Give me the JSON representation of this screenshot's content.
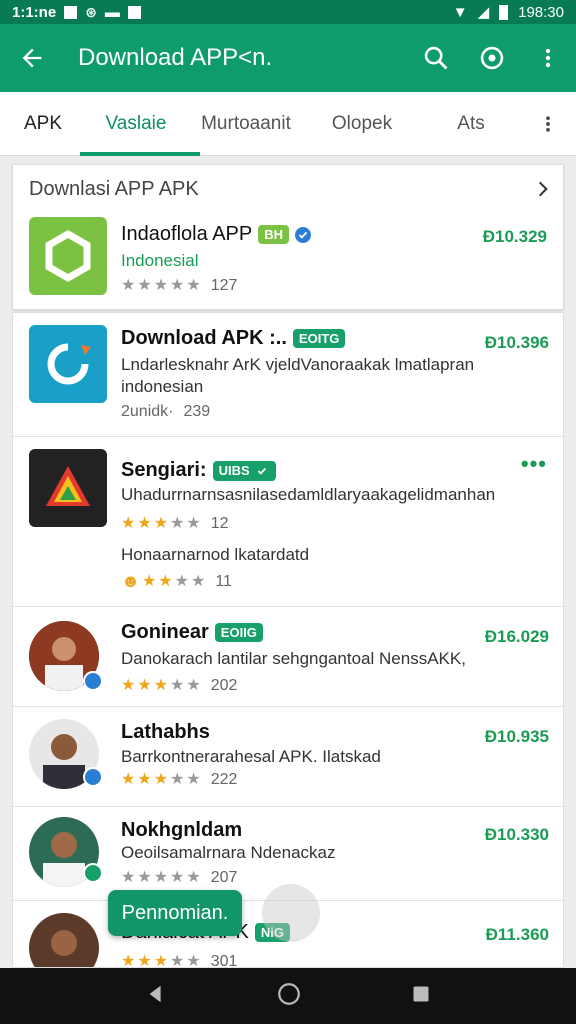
{
  "status": {
    "time_left": "1:1:ne",
    "time_right": "198:30"
  },
  "app_bar": {
    "title": "Download APP<n."
  },
  "tabs": [
    "APK",
    "Vaslaie",
    "Murtoaanit",
    "Olopek",
    "Ats"
  ],
  "featured": {
    "header": "Downlasi APP APK",
    "item": {
      "name": "Indaoflola APP",
      "badge": "BH",
      "subtitle": "Indonesial",
      "rating_count": "127",
      "price": "Ð10.329",
      "stars": 0
    }
  },
  "list": [
    {
      "name": "Download APK :..",
      "badge": "EOITG",
      "desc1": "Lndarlesknahr ArK vjeldVanoraakak lmatlapran",
      "desc2": "indonesian",
      "rating_label": "2unidk·",
      "rating_count": "239",
      "price": "Ð10.396"
    },
    {
      "name": "Sengiari:",
      "badge": "UIBS",
      "desc1": "Uhadurrnarnsasnilasedamldlaryaakagelidmanhan",
      "rating_count": "12",
      "stars": 3,
      "extra_line": "Honaarnarnod lkatardatd",
      "extra_count": "11"
    },
    {
      "name": "Goninear",
      "badge": "EOIIG",
      "desc1": "Danokarach lantilar sehgngantoal NenssAKK,",
      "rating_count": "202",
      "stars": 3,
      "price": "Ð16.029"
    },
    {
      "name": "Lathabhs",
      "desc1": "Barrkontnerarahesal APK. Ilatskad",
      "rating_count": "222",
      "stars": 3,
      "price": "Ð10.935"
    },
    {
      "name": "Nokhgnldam",
      "desc1": "Oeoilsamalrnara Ndenackaz",
      "rating_count": "207",
      "stars": 0,
      "price": "Ð10.330"
    },
    {
      "name": "Danlaicat APK",
      "badge": "NiG",
      "rating_count": "301",
      "price": "Ð11.360"
    }
  ],
  "snackbar": "Pennomian.",
  "colors": {
    "primary": "#0e9c6d",
    "primary_dark": "#087a55",
    "accent_green": "#1a9c55",
    "star": "#f0a61c"
  }
}
